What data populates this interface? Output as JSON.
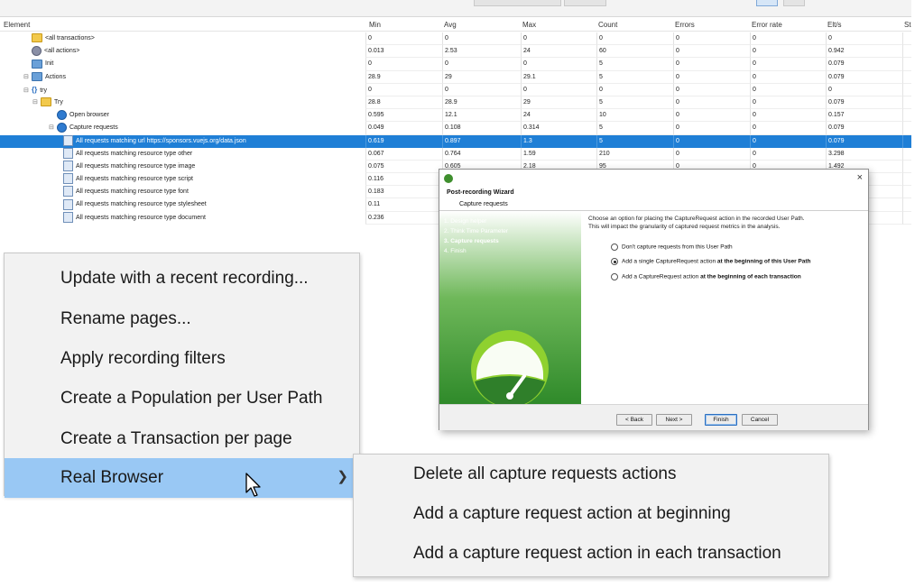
{
  "table": {
    "headers": {
      "element": "Element",
      "min": "Min",
      "avg": "Avg",
      "max": "Max",
      "count": "Count",
      "errors": "Errors",
      "error_rate": "Error rate",
      "elts": "Elt/s",
      "st": "St"
    },
    "rows": [
      {
        "name": "<all transactions>",
        "icon": "folder-icon",
        "depth": 1,
        "min": "0",
        "avg": "0",
        "max": "0",
        "count": "0",
        "errors": "0",
        "error_rate": "0",
        "elts": "0"
      },
      {
        "name": "<all actions>",
        "icon": "gear-icon",
        "depth": 1,
        "min": "0.013",
        "avg": "2.53",
        "max": "24",
        "count": "60",
        "errors": "0",
        "error_rate": "0",
        "elts": "0.942"
      },
      {
        "name": "Init",
        "icon": "folder-blue-icon",
        "depth": 1,
        "min": "0",
        "avg": "0",
        "max": "0",
        "count": "5",
        "errors": "0",
        "error_rate": "0",
        "elts": "0.079"
      },
      {
        "name": "Actions",
        "icon": "folder-blue-icon",
        "depth": 1,
        "min": "28.9",
        "avg": "29",
        "max": "29.1",
        "count": "5",
        "errors": "0",
        "error_rate": "0",
        "elts": "0.079"
      },
      {
        "name": "try",
        "icon": "braces-icon",
        "depth": 2,
        "min": "0",
        "avg": "0",
        "max": "0",
        "count": "0",
        "errors": "0",
        "error_rate": "0",
        "elts": "0"
      },
      {
        "name": "Try",
        "icon": "folder-icon",
        "depth": 3,
        "min": "28.8",
        "avg": "28.9",
        "max": "29",
        "count": "5",
        "errors": "0",
        "error_rate": "0",
        "elts": "0.079"
      },
      {
        "name": "Open browser",
        "icon": "globe-icon",
        "depth": 4,
        "min": "0.595",
        "avg": "12.1",
        "max": "24",
        "count": "10",
        "errors": "0",
        "error_rate": "0",
        "elts": "0.157"
      },
      {
        "name": "Capture requests",
        "icon": "globe-icon",
        "depth": 4,
        "min": "0.049",
        "avg": "0.108",
        "max": "0.314",
        "count": "5",
        "errors": "0",
        "error_rate": "0",
        "elts": "0.079"
      },
      {
        "name": "All requests matching url https://sponsors.vuejs.org/data.json",
        "icon": "page-icon",
        "depth": 5,
        "selected": true,
        "min": "0.619",
        "avg": "0.897",
        "max": "1.3",
        "count": "5",
        "errors": "0",
        "error_rate": "0",
        "elts": "0.079"
      },
      {
        "name": "All requests matching resource type other",
        "icon": "page-icon",
        "depth": 5,
        "min": "0.067",
        "avg": "0.764",
        "max": "1.59",
        "count": "210",
        "errors": "0",
        "error_rate": "0",
        "elts": "3.298"
      },
      {
        "name": "All requests matching resource type image",
        "icon": "page-icon",
        "depth": 5,
        "min": "0.075",
        "avg": "0.605",
        "max": "2.18",
        "count": "95",
        "errors": "0",
        "error_rate": "0",
        "elts": "1.492"
      },
      {
        "name": "All requests matching resource type script",
        "icon": "page-icon",
        "depth": 5,
        "min": "0.116",
        "avg": "",
        "max": "",
        "count": "",
        "errors": "",
        "error_rate": "",
        "elts": ""
      },
      {
        "name": "All requests matching resource type font",
        "icon": "page-icon",
        "depth": 5,
        "min": "0.183",
        "avg": "",
        "max": "",
        "count": "",
        "errors": "",
        "error_rate": "",
        "elts": ""
      },
      {
        "name": "All requests matching resource type stylesheet",
        "icon": "page-icon",
        "depth": 5,
        "min": "0.11",
        "avg": "",
        "max": "",
        "count": "",
        "errors": "",
        "error_rate": "",
        "elts": ""
      },
      {
        "name": "All requests matching resource type document",
        "icon": "page-icon",
        "depth": 5,
        "min": "0.236",
        "avg": "",
        "max": "",
        "count": "",
        "errors": "",
        "error_rate": "",
        "elts": ""
      }
    ]
  },
  "context_menu": {
    "items": [
      {
        "label": "Update with a recent recording..."
      },
      {
        "label": "Rename pages..."
      },
      {
        "label": "Apply recording filters"
      },
      {
        "label": "Create a Population per User Path"
      },
      {
        "label": "Create a Transaction per page"
      },
      {
        "label": "Real Browser",
        "highlighted": true,
        "submenu_icon": "chevron-right-icon"
      }
    ],
    "submenu": [
      {
        "label": "Delete all capture requests actions"
      },
      {
        "label": "Add a capture request action at beginning"
      },
      {
        "label": "Add a capture request action in each transaction"
      }
    ]
  },
  "wizard": {
    "title": "Post-recording Wizard",
    "subtitle": "Capture requests",
    "close": "×",
    "steps": [
      "1. Design helper",
      "2. Think Time Parameter",
      "3. Capture requests",
      "4. Finish"
    ],
    "current_step": 2,
    "description_line1": "Choose an option for placing the CaptureRequest action in the recorded User Path.",
    "description_line2": "This will impact the granularity of captured request metrics in the analysis.",
    "options": [
      {
        "text": "Don't capture requests from this User Path",
        "bold": "",
        "selected": false
      },
      {
        "text": "Add a single CaptureRequest action ",
        "bold": "at the beginning of this User Path",
        "selected": true
      },
      {
        "text": "Add a CaptureRequest action ",
        "bold": "at the beginning of each transaction",
        "selected": false
      }
    ],
    "buttons": {
      "back": "< Back",
      "next": "Next >",
      "finish": "Finish",
      "cancel": "Cancel"
    },
    "accent_color": "#3f8f2e"
  },
  "colors": {
    "selection": "#1f7fd6",
    "menu_highlight": "#99c8f4"
  }
}
